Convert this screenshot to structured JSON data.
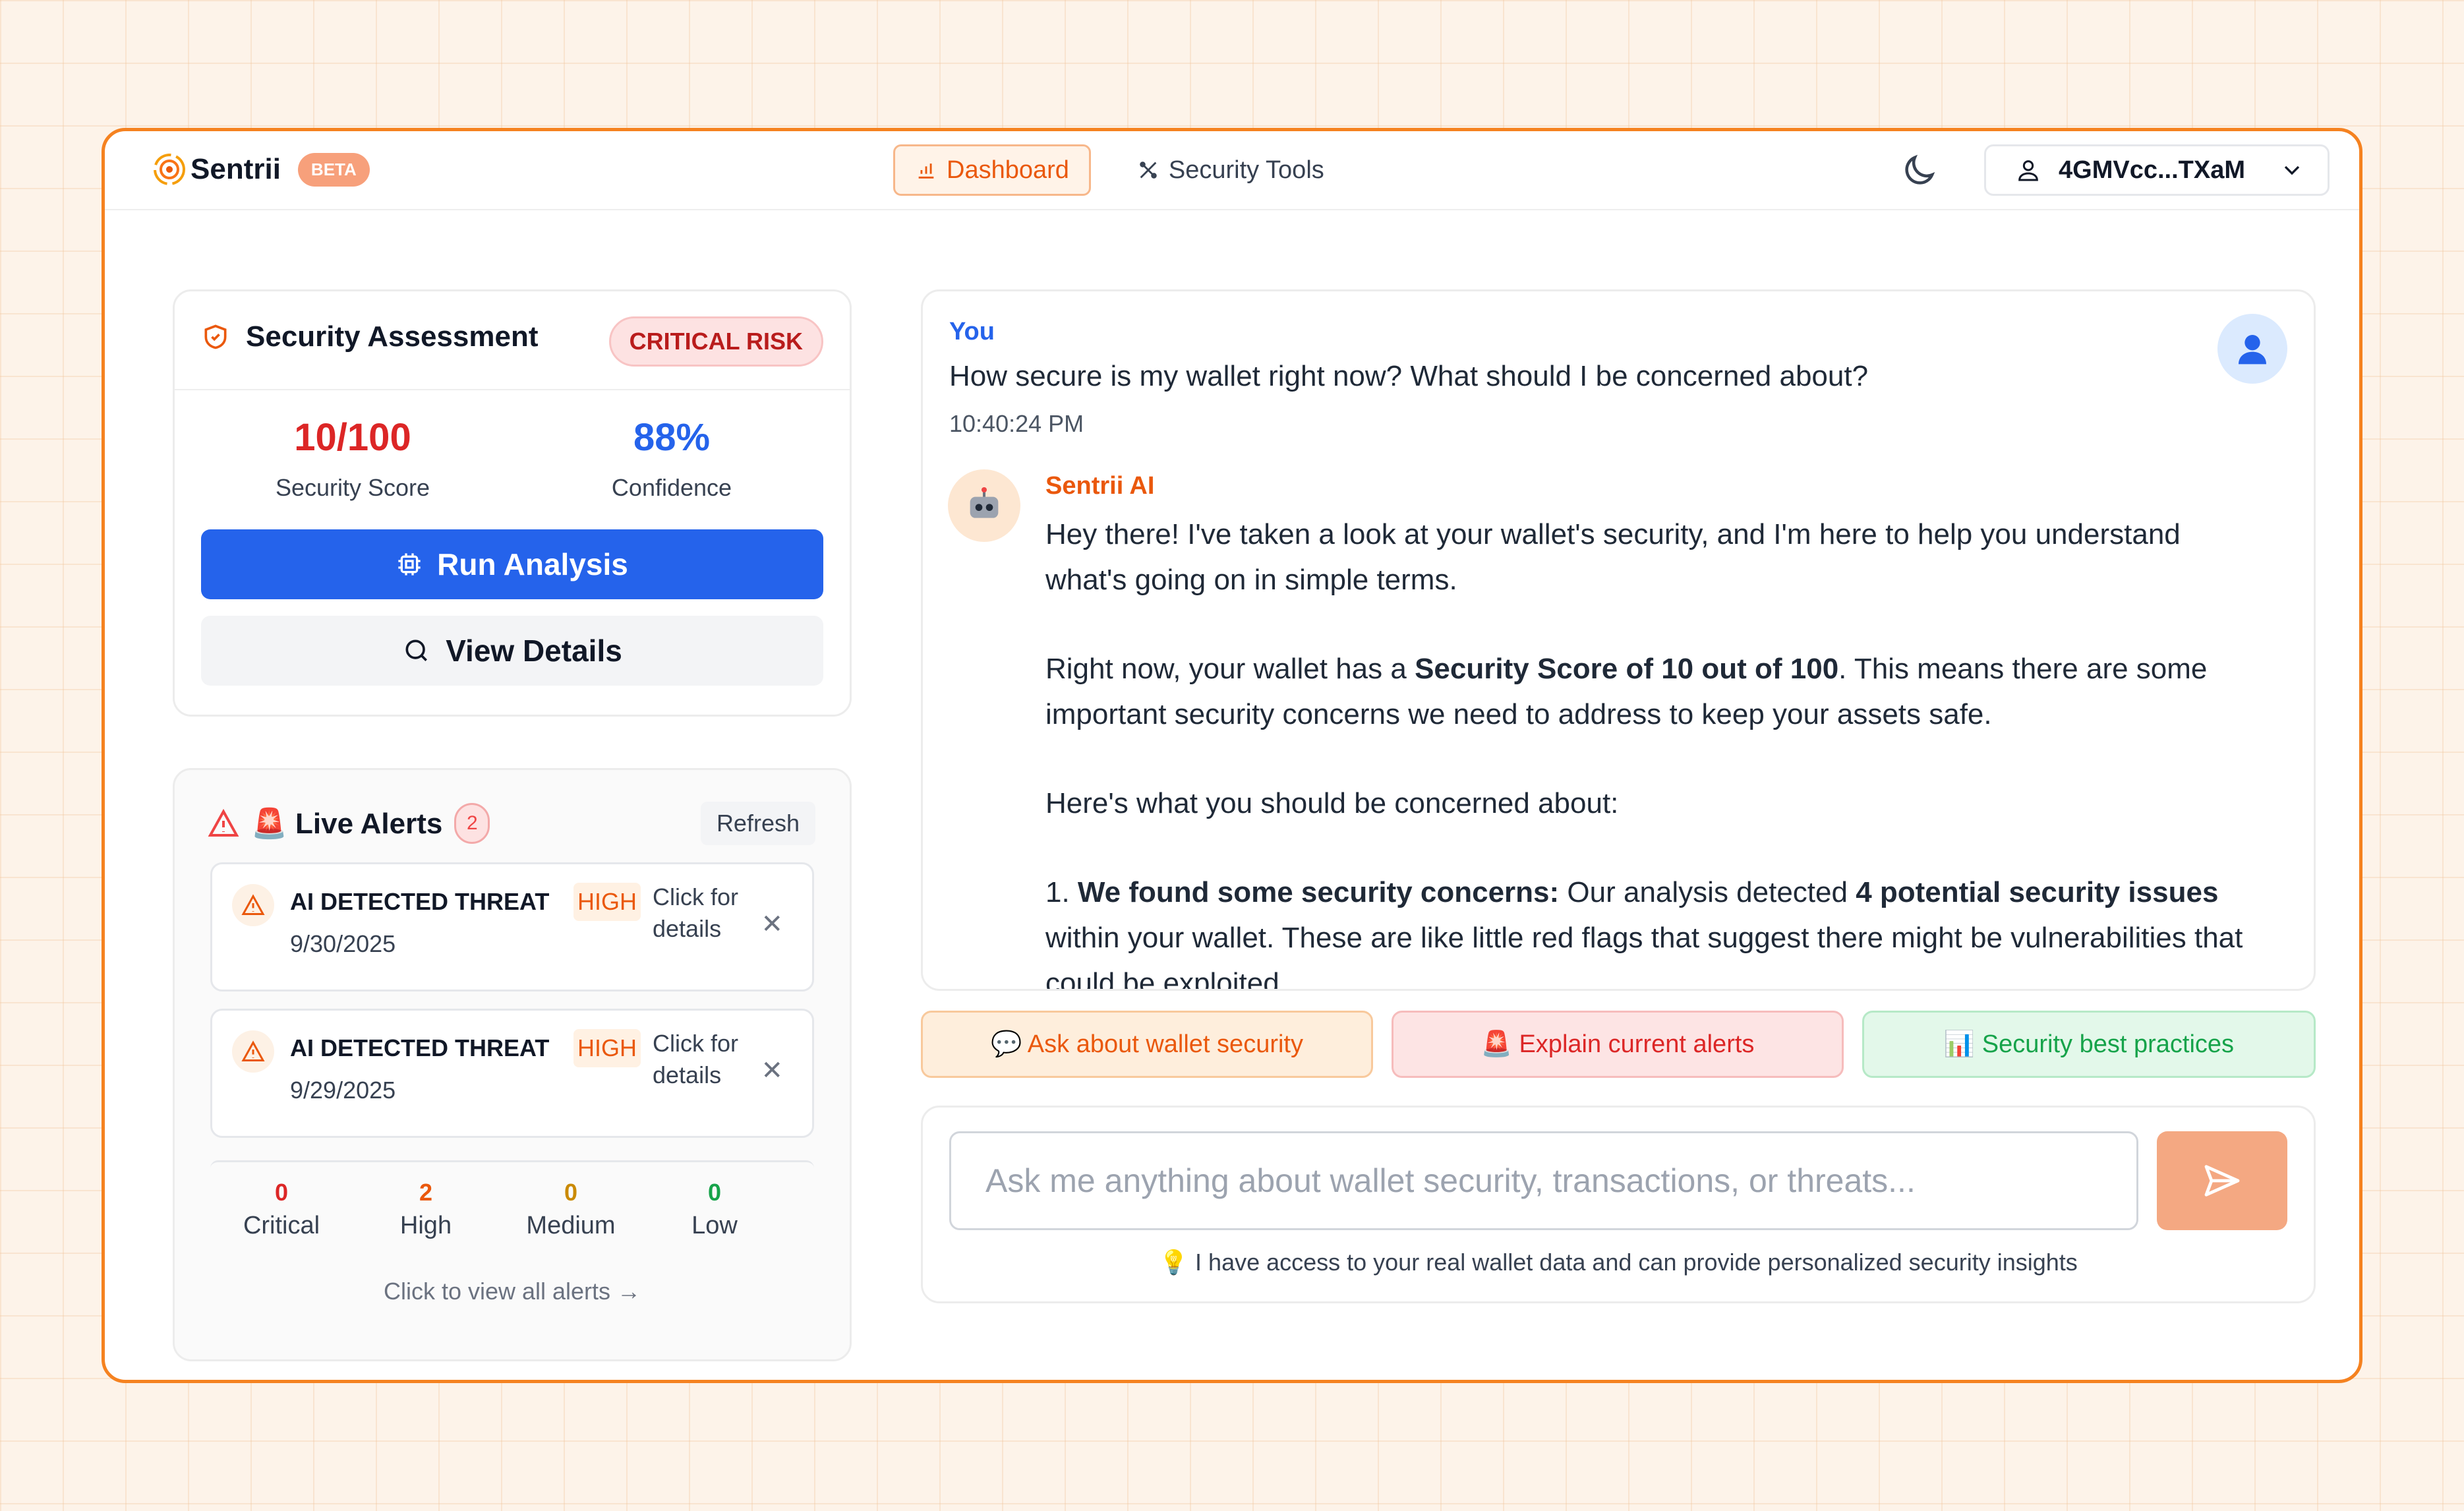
{
  "app": {
    "name": "Sentrii",
    "badge": "BETA"
  },
  "nav": {
    "dashboard": {
      "label": "Dashboard",
      "icon": "bar-chart-icon"
    },
    "security_tools": {
      "label": "Security Tools",
      "icon": "tools-icon"
    }
  },
  "wallet": {
    "address": "4GMVcc...TXaM"
  },
  "assessment": {
    "title": "Security Assessment",
    "risk_label": "CRITICAL RISK",
    "score_value": "10/100",
    "score_label": "Security Score",
    "confidence_value": "88%",
    "confidence_label": "Confidence",
    "run_button": "Run Analysis",
    "view_button": "View Details"
  },
  "alerts": {
    "title": "🚨 Live Alerts",
    "count": "2",
    "refresh": "Refresh",
    "items": [
      {
        "title": "AI DETECTED THREAT",
        "severity": "HIGH",
        "action": "Click for details",
        "date": "9/30/2025"
      },
      {
        "title": "AI DETECTED THREAT",
        "severity": "HIGH",
        "action": "Click for details",
        "date": "9/29/2025"
      }
    ],
    "stats": [
      {
        "value": "0",
        "label": "Critical",
        "color": "#dc2626"
      },
      {
        "value": "2",
        "label": "High",
        "color": "#ea580c"
      },
      {
        "value": "0",
        "label": "Medium",
        "color": "#ca8a04"
      },
      {
        "value": "0",
        "label": "Low",
        "color": "#16a34a"
      }
    ],
    "view_all": "Click to view all alerts →"
  },
  "chat": {
    "user_label": "You",
    "user_message": "How secure is my wallet right now? What should I be concerned about?",
    "user_time": "10:40:24 PM",
    "bot_label": "Sentrii AI",
    "bot_p1": "Hey there! I've taken a look at your wallet's security, and I'm here to help you understand what's going on in simple terms.",
    "bot_p2_pre": "Right now, your wallet has a ",
    "bot_p2_bold": "Security Score of 10 out of 100",
    "bot_p2_post": ". This means there are some important security concerns we need to address to keep your assets safe.",
    "bot_p3": "Here's what you should be concerned about:",
    "bot_p4_num": "1. ",
    "bot_p4_bold1": "We found some security concerns:",
    "bot_p4_mid": " Our analysis detected ",
    "bot_p4_bold2": "4 potential security issues",
    "bot_p4_post": " within your wallet. These are like little red flags that suggest there might be vulnerabilities that could be exploited."
  },
  "quick_actions": [
    {
      "label": "💬 Ask about wallet security"
    },
    {
      "label": "🚨 Explain current alerts"
    },
    {
      "label": "📊 Security best practices"
    }
  ],
  "input": {
    "placeholder": "Ask me anything about wallet security, transactions, or threats...",
    "hint": "💡 I have access to your real wallet data and can provide personalized security insights"
  }
}
